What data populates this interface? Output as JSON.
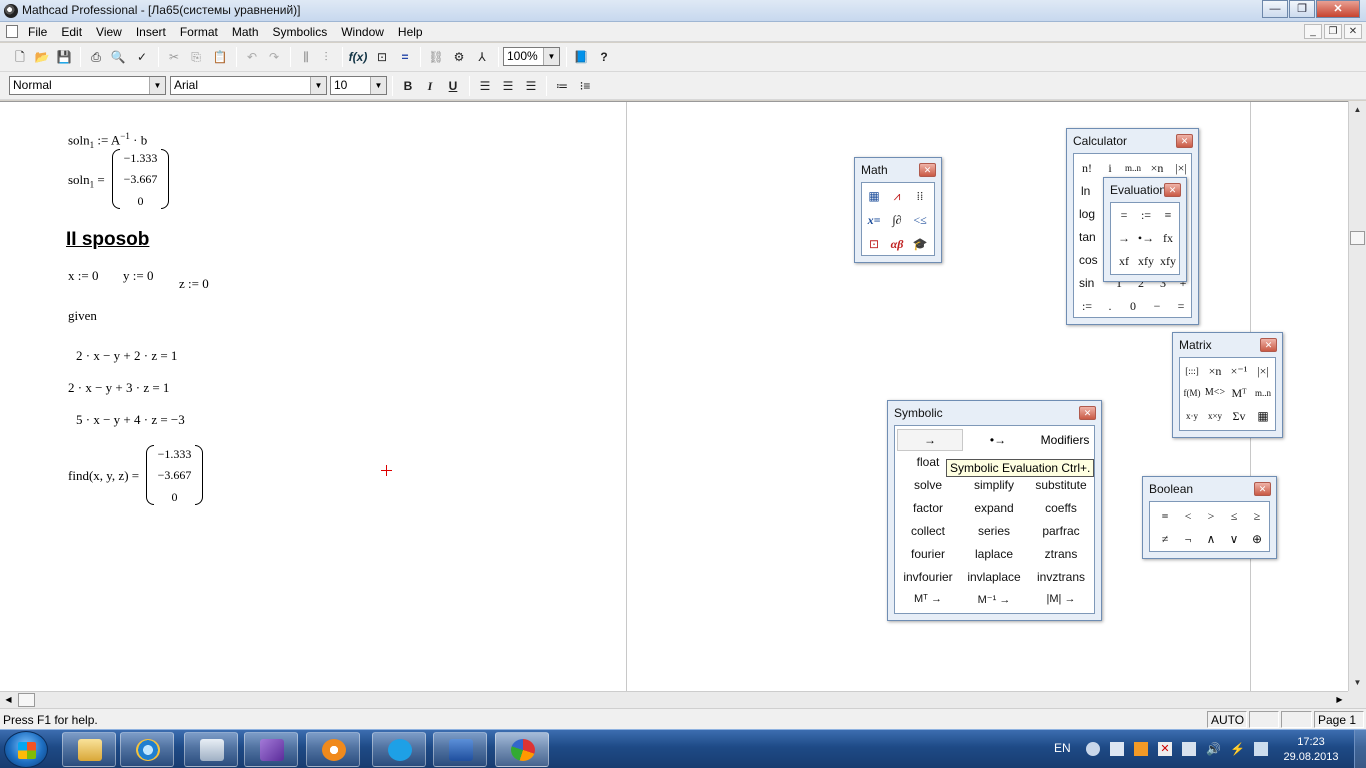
{
  "window": {
    "title": "Mathcad Professional - [Ла65(системы уравнений)]",
    "minimize": "—",
    "maximize": "❐",
    "close": "✕"
  },
  "menu": [
    "File",
    "Edit",
    "View",
    "Insert",
    "Format",
    "Math",
    "Symbolics",
    "Window",
    "Help"
  ],
  "mdi": {
    "minimize": "_",
    "restore": "❐",
    "close": "✕"
  },
  "toolbar": {
    "zoom": "100%"
  },
  "format_bar": {
    "style": "Normal",
    "font": "Arial",
    "size": "10",
    "bold": "B",
    "italic": "I",
    "underline": "U"
  },
  "worksheet": {
    "soln1_def": "soln",
    "soln1_def_sub": "1",
    "soln1_def_rhs": " := A",
    "soln1_def_sup": "−1",
    "soln1_def_tail": " · b",
    "soln1_eval": "soln",
    "soln1_eval_sub": "1",
    "soln1_eval_eq": " =",
    "soln1_values": [
      "−1.333",
      "−3.667",
      "0"
    ],
    "heading": "II sposob",
    "x_init": "x := 0",
    "y_init": "y := 0",
    "z_init": "z := 0",
    "given": "given",
    "eq1": "2 · x − y + 2 · z = 1",
    "eq2": "2 · x − y + 3 · z = 1",
    "eq3": "5 · x − y + 4 · z = −3",
    "find": "find(x, y, z) =",
    "find_values": [
      "−1.333",
      "−3.667",
      "0"
    ]
  },
  "palettes": {
    "math": {
      "title": "Math",
      "close": "✕"
    },
    "calculator": {
      "title": "Calculator",
      "close": "✕",
      "row1": [
        "n!",
        "i",
        "m..n",
        "×n",
        "|×|"
      ],
      "side": [
        "ln",
        "log",
        "tan",
        "cos",
        "sin"
      ],
      "row_sin": [
        "1",
        "2",
        "3",
        "+"
      ],
      "bottom": [
        ":=",
        ".",
        "0",
        "−",
        "="
      ]
    },
    "evaluation": {
      "title": "Evaluation",
      "close": "✕",
      "cells": [
        "=",
        ":=",
        "≡",
        "→",
        "•→",
        "fx",
        "xf",
        "xfy",
        "xfy"
      ]
    },
    "matrix": {
      "title": "Matrix",
      "close": "✕",
      "cells": [
        "[:::]",
        "×n",
        "×⁻¹",
        "|×|",
        "f(M)",
        "M<>",
        "Mᵀ",
        "m..n",
        "x·y",
        "x×y",
        "Σv",
        "▦"
      ]
    },
    "symbolic": {
      "title": "Symbolic",
      "close": "✕",
      "top": [
        "→",
        "•→",
        "Modifiers"
      ],
      "rows": [
        [
          "float",
          "",
          ""
        ],
        [
          "solve",
          "simplify",
          "substitute"
        ],
        [
          "factor",
          "expand",
          "coeffs"
        ],
        [
          "collect",
          "series",
          "parfrac"
        ],
        [
          "fourier",
          "laplace",
          "ztrans"
        ],
        [
          "invfourier",
          "invlaplace",
          "invztrans"
        ],
        [
          "Mᵀ →",
          "M⁻¹ →",
          "|M| →"
        ]
      ]
    },
    "boolean": {
      "title": "Boolean",
      "close": "✕",
      "cells": [
        "=",
        "<",
        ">",
        "≤",
        "≥",
        "≠",
        "¬",
        "∧",
        "∨",
        "⊕"
      ]
    }
  },
  "tooltip": "Symbolic Evaluation Ctrl+.",
  "status": {
    "help": "Press F1 for help.",
    "mode": "AUTO",
    "page": "Page 1"
  },
  "taskbar": {
    "lang": "EN",
    "time": "17:23",
    "date": "29.08.2013"
  }
}
